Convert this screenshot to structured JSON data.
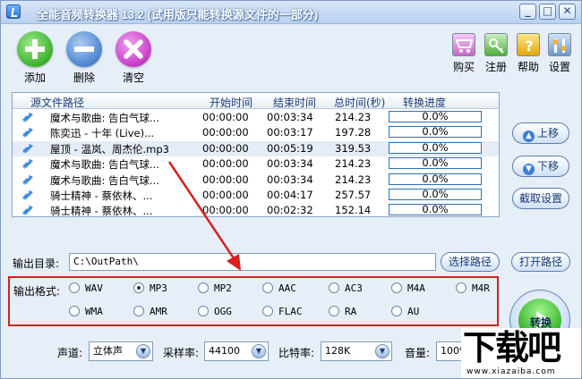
{
  "window": {
    "title": "全能音频转换器 13.2 (试用版只能转换源文件的一部分)",
    "min": "_",
    "max": "□",
    "close": "✕"
  },
  "toolbar": {
    "add": "添加",
    "delete": "删除",
    "clear": "清空"
  },
  "right_toolbar": {
    "buy": "购买",
    "register": "注册",
    "help": "帮助",
    "settings": "设置"
  },
  "list": {
    "headers": {
      "path": "源文件路径",
      "start": "开始时间",
      "end": "结束时间",
      "total": "总时间(秒)",
      "progress": "转换进度"
    },
    "rows": [
      {
        "name": "魔术与歌曲: 告白气球...",
        "start": "00:00:00",
        "end": "00:03:34",
        "total": "214.23",
        "progress": "0.0%"
      },
      {
        "name": "陈奕迅 - 十年 (Live)...",
        "start": "00:00:00",
        "end": "00:03:17",
        "total": "197.28",
        "progress": "0.0%"
      },
      {
        "name": "屋顶 - 温岚、周杰伦.mp3",
        "start": "00:00:00",
        "end": "00:05:19",
        "total": "319.53",
        "progress": "0.0%"
      },
      {
        "name": "魔术与歌曲: 告白气球...",
        "start": "00:00:00",
        "end": "00:03:34",
        "total": "214.23",
        "progress": "0.0%"
      },
      {
        "name": "魔术与歌曲: 告白气球...",
        "start": "00:00:00",
        "end": "00:03:34",
        "total": "214.23",
        "progress": "0.0%"
      },
      {
        "name": "骑士精神 - 蔡依林、...",
        "start": "00:00:00",
        "end": "00:04:17",
        "total": "257.57",
        "progress": "0.0%"
      },
      {
        "name": "骑士精神 - 蔡依林、...",
        "start": "00:00:00",
        "end": "00:02:32",
        "total": "152.14",
        "progress": "0.0%"
      }
    ]
  },
  "side": {
    "up": "上移",
    "down": "下移",
    "cut": "截取设置",
    "open_path": "打开路径",
    "convert": "转换"
  },
  "output": {
    "label": "输出目录:",
    "path": "C:\\OutPath\\",
    "choose": "选择路径"
  },
  "formats": {
    "label": "输出格式:",
    "row1": [
      "WAV",
      "MP3",
      "MP2",
      "AAC",
      "AC3",
      "M4A",
      "M4R"
    ],
    "row2": [
      "WMA",
      "AMR",
      "OGG",
      "FLAC",
      "RA",
      "AU"
    ],
    "selected": "MP3"
  },
  "bottom": {
    "channel_label": "声道:",
    "channel": "立体声",
    "rate_label": "采样率:",
    "rate": "44100",
    "bitrate_label": "比特率:",
    "bitrate": "128K",
    "volume_label": "音量:",
    "volume": "100%"
  },
  "watermark": {
    "big": "下载吧",
    "small": "www.xiazaiba.com"
  },
  "colors": {
    "annotation": "#d81e1e",
    "accent": "#2f6fb4"
  }
}
